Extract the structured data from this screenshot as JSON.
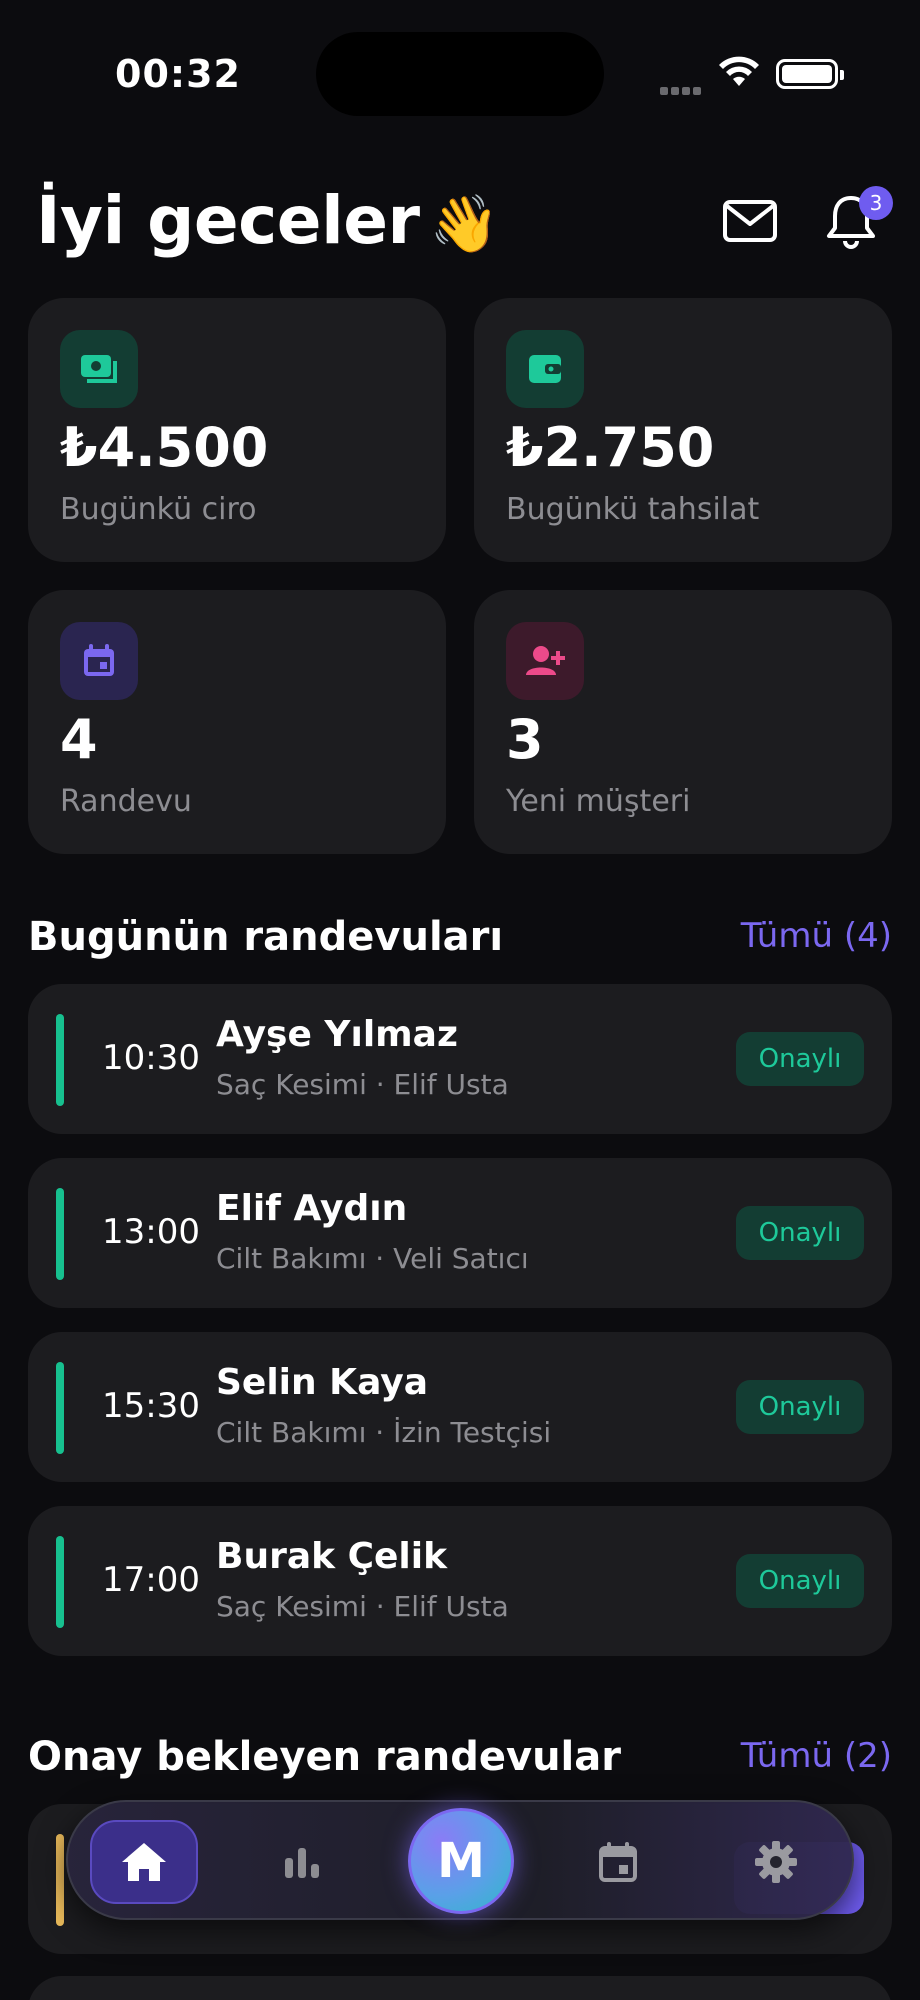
{
  "status_bar": {
    "time": "00:32"
  },
  "header": {
    "greeting": "İyi geceler",
    "wave_emoji": "👋",
    "notification_count": "3",
    "mail_icon": "mail-icon",
    "bell_icon": "bell-icon"
  },
  "stats": [
    {
      "value": "₺4.500",
      "label": "Bugünkü ciro",
      "icon": "cash-icon",
      "icon_color": "#1ec99a",
      "icon_bg": "#133d33"
    },
    {
      "value": "₺2.750",
      "label": "Bugünkü tahsilat",
      "icon": "wallet-icon",
      "icon_color": "#1ec99a",
      "icon_bg": "#133d33"
    },
    {
      "value": "4",
      "label": "Randevu",
      "icon": "calendar-icon",
      "icon_color": "#7b68f0",
      "icon_bg": "#2a2550"
    },
    {
      "value": "3",
      "label": "Yeni müşteri",
      "icon": "add-person-icon",
      "icon_color": "#ec4a8a",
      "icon_bg": "#3d1a2b"
    }
  ],
  "today": {
    "title": "Bugünün randevuları",
    "link": "Tümü (4)",
    "appointments": [
      {
        "time": "10:30",
        "name": "Ayşe Yılmaz",
        "detail": "Saç Kesimi · Elif Usta",
        "status": "Onaylı"
      },
      {
        "time": "13:00",
        "name": "Elif Aydın",
        "detail": "Cilt Bakımı · Veli Satıcı",
        "status": "Onaylı"
      },
      {
        "time": "15:30",
        "name": "Selin Kaya",
        "detail": "Cilt Bakımı · İzin Testçisi",
        "status": "Onaylı"
      },
      {
        "time": "17:00",
        "name": "Burak Çelik",
        "detail": "Saç Kesimi · Elif Usta",
        "status": "Onaylı"
      }
    ]
  },
  "pending": {
    "title": "Onay bekleyen randevular",
    "link": "Tümü (2)"
  },
  "bottom_nav": {
    "center_label": "M",
    "items": [
      "home-icon",
      "chart-icon",
      "calendar-icon",
      "settings-icon"
    ]
  },
  "colors": {
    "accent": "#7b68f0",
    "success": "#1ec99a",
    "pending": "#e8b95a"
  }
}
